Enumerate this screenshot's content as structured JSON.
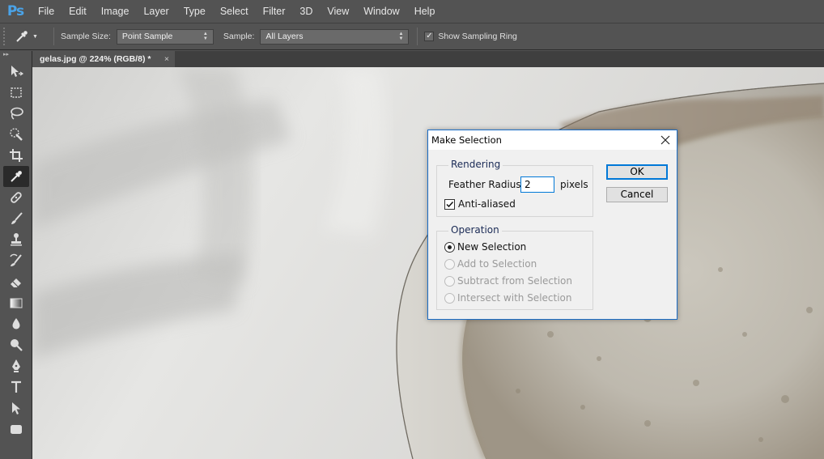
{
  "app": {
    "logo": "Ps"
  },
  "menu": [
    "File",
    "Edit",
    "Image",
    "Layer",
    "Type",
    "Select",
    "Filter",
    "3D",
    "View",
    "Window",
    "Help"
  ],
  "options": {
    "tool_icon": "eyedropper-icon",
    "sample_size_label": "Sample Size:",
    "sample_size_value": "Point Sample",
    "sample_label": "Sample:",
    "sample_value": "All Layers",
    "show_ring_label": "Show Sampling Ring",
    "show_ring_checked": true
  },
  "document_tab": {
    "title": "gelas.jpg @ 224% (RGB/8) *",
    "close": "×"
  },
  "toolbar": {
    "collapse": "▸▸",
    "tools": [
      "move-icon",
      "marquee-icon",
      "lasso-icon",
      "quick-selection-icon",
      "crop-icon",
      "eyedropper-icon",
      "healing-brush-icon",
      "brush-icon",
      "clone-stamp-icon",
      "history-brush-icon",
      "eraser-icon",
      "gradient-icon",
      "blur-icon",
      "dodge-icon",
      "pen-icon",
      "type-icon",
      "path-selection-icon",
      "rectangle-icon"
    ],
    "active": "eyedropper-icon"
  },
  "dialog": {
    "title": "Make Selection",
    "rendering": {
      "legend": "Rendering",
      "feather_label": "Feather Radius:",
      "feather_value": "2",
      "feather_unit": "pixels",
      "antialias_label": "Anti-aliased",
      "antialias_checked": true
    },
    "operation": {
      "legend": "Operation",
      "options": [
        {
          "label": "New Selection",
          "selected": true,
          "enabled": true
        },
        {
          "label": "Add to Selection",
          "selected": false,
          "enabled": false
        },
        {
          "label": "Subtract from Selection",
          "selected": false,
          "enabled": false
        },
        {
          "label": "Intersect with Selection",
          "selected": false,
          "enabled": false
        }
      ]
    },
    "ok_label": "OK",
    "cancel_label": "Cancel"
  }
}
